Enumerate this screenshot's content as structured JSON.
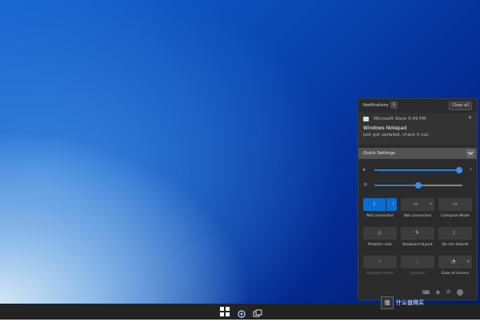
{
  "notifications": {
    "title": "Notifications",
    "count": "1",
    "clear_all": "Clear all",
    "items": [
      {
        "app": "Microsoft Store",
        "time": "5:49 PM",
        "app_time": "Microsoft Store  5:49 PM",
        "heading": "Windows Notepad",
        "body": "Just got updated, check it out."
      }
    ]
  },
  "quick_settings": {
    "title": "Quick Settings",
    "volume": {
      "icon": "speaker-icon",
      "value": 0.96
    },
    "brightness": {
      "icon": "brightness-icon",
      "value": 0.5
    },
    "tiles": [
      {
        "label": "Not connected",
        "icon": "bluetooth-icon",
        "active": true,
        "has_chevron": true,
        "enabled": true
      },
      {
        "label": "Not connected",
        "icon": "cast-icon",
        "active": false,
        "has_chevron": true,
        "enabled": true
      },
      {
        "label": "Compose Mode",
        "icon": "compose-icon",
        "active": false,
        "has_chevron": false,
        "enabled": true
      },
      {
        "label": "Rotation lock",
        "icon": "rotation-icon",
        "active": false,
        "has_chevron": false,
        "enabled": true
      },
      {
        "label": "Keyboard layout",
        "icon": "keyboard-layout-icon",
        "active": false,
        "has_chevron": false,
        "enabled": true
      },
      {
        "label": "Do not disturb",
        "icon": "moon-icon",
        "active": false,
        "has_chevron": false,
        "enabled": true
      },
      {
        "label": "Airplane mode",
        "icon": "airplane-icon",
        "active": false,
        "has_chevron": false,
        "enabled": false
      },
      {
        "label": "Location",
        "icon": "location-icon",
        "active": false,
        "has_chevron": false,
        "enabled": false
      },
      {
        "label": "Ease of Access",
        "icon": "ease-of-access-icon",
        "active": false,
        "has_chevron": true,
        "enabled": true
      }
    ]
  },
  "watermark": {
    "text": "什么值得买"
  },
  "colors": {
    "accent": "#0a6ed1",
    "panel": "#2b2b2b",
    "taskbar": "#232323"
  }
}
